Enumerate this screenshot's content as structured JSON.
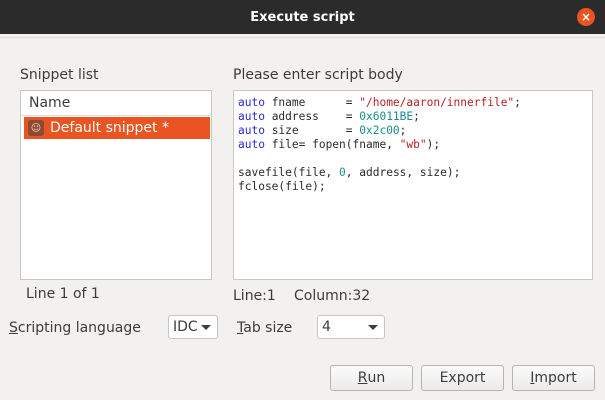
{
  "window": {
    "title": "Execute script",
    "close_symbol": "×"
  },
  "snippets": {
    "label": "Snippet list",
    "column_header": "Name",
    "items": [
      {
        "label": "Default snippet *",
        "selected": true
      }
    ],
    "position_text": "Line 1 of 1"
  },
  "editor": {
    "label": "Please enter script body",
    "line_status": "Line:1",
    "column_status": "Column:32",
    "lines": [
      [
        {
          "t": "auto",
          "c": "kw"
        },
        {
          "t": " fname      = "
        },
        {
          "t": "\"/home/aaron/innerfile\"",
          "c": "str"
        },
        {
          "t": ";"
        }
      ],
      [
        {
          "t": "auto",
          "c": "kw"
        },
        {
          "t": " address    = "
        },
        {
          "t": "0x6011BE",
          "c": "num"
        },
        {
          "t": ";"
        }
      ],
      [
        {
          "t": "auto",
          "c": "kw"
        },
        {
          "t": " size       = "
        },
        {
          "t": "0x2c00",
          "c": "num"
        },
        {
          "t": ";"
        }
      ],
      [
        {
          "t": "auto",
          "c": "kw"
        },
        {
          "t": " file= fopen(fname, "
        },
        {
          "t": "\"wb\"",
          "c": "str"
        },
        {
          "t": ");"
        }
      ],
      [],
      [
        {
          "t": "savefile(file, "
        },
        {
          "t": "0",
          "c": "num"
        },
        {
          "t": ", address, size);"
        }
      ],
      [
        {
          "t": "fclose(file);"
        }
      ]
    ]
  },
  "options": {
    "language_label_first": "S",
    "language_label_rest": "cripting language",
    "language_value": "IDC",
    "tab_label_first": "T",
    "tab_label_rest": "ab size",
    "tab_value": "4"
  },
  "buttons": {
    "run_first": "R",
    "run_rest": "un",
    "export": "Export",
    "import_first": "I",
    "import_rest": "mport"
  },
  "colors": {
    "accent": "#e95420",
    "titlebar": "#2b2b2b",
    "background": "#f2f1f0"
  }
}
